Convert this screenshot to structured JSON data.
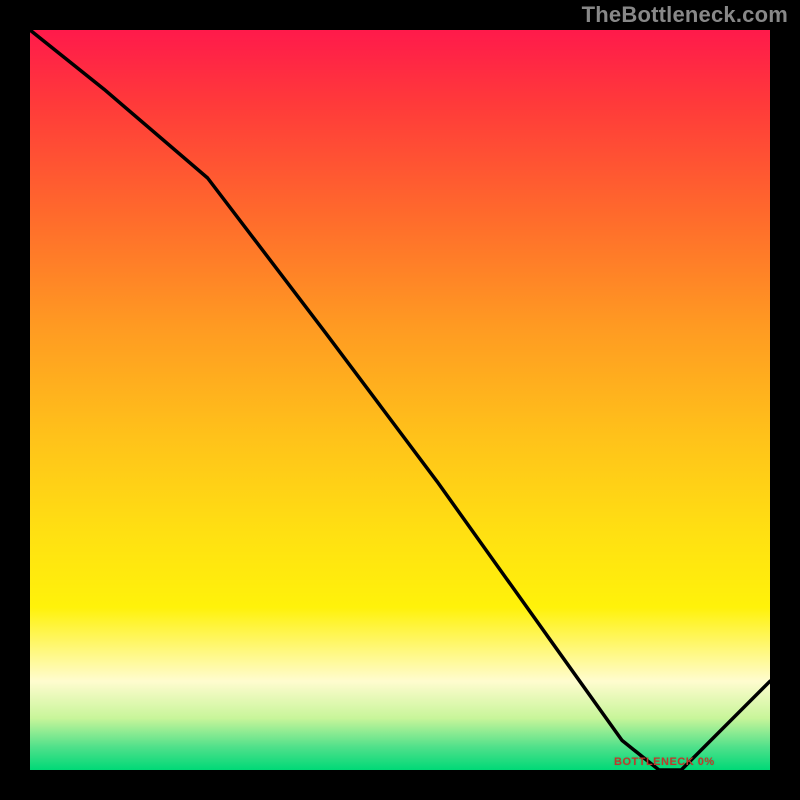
{
  "watermark": "TheBottleneck.com",
  "min_label": "BOTTLENECK 0%",
  "chart_data": {
    "type": "line",
    "title": "",
    "xlabel": "",
    "ylabel": "",
    "xlim": [
      0,
      100
    ],
    "ylim": [
      0,
      100
    ],
    "gradient_meaning": "background color maps bottleneck percentage: red=100 at top, green=0 at bottom",
    "series": [
      {
        "name": "bottleneck-curve",
        "x": [
          0,
          10,
          24,
          40,
          55,
          70,
          80,
          85,
          88,
          100
        ],
        "y": [
          100,
          92,
          80,
          59,
          39,
          18,
          4,
          0,
          0,
          12
        ]
      }
    ],
    "min_region_x": [
      80,
      90
    ],
    "min_value": 0
  },
  "colors": {
    "curve": "#000000",
    "background_frame": "#000000"
  }
}
